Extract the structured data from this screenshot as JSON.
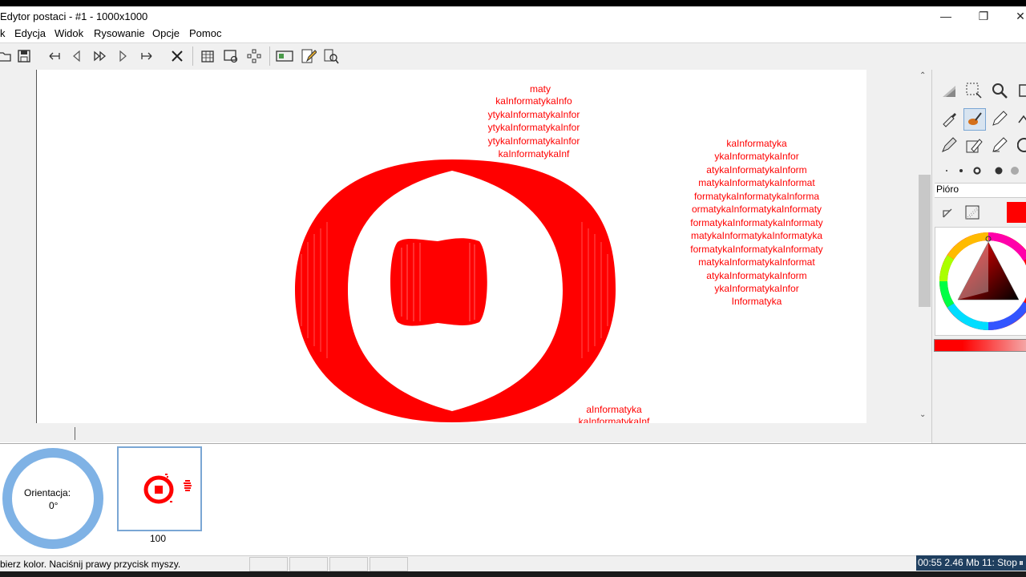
{
  "window": {
    "title": "Edytor postaci - #1 - 1000x1000",
    "controls": {
      "minimize": "—",
      "restore": "❐",
      "close": "✕"
    }
  },
  "menu": [
    "k",
    "Edycja",
    "Widok",
    "Rysowanie",
    "Opcje",
    "Pomoc"
  ],
  "toolbar_icons": [
    "open-icon",
    "save-icon",
    "first-frame-icon",
    "prev-frame-icon",
    "fast-forward-icon",
    "next-frame-icon",
    "last-frame-icon",
    "delete-icon",
    "grid-icon",
    "preview-icon",
    "move-icon",
    "frame-icon",
    "pencil-edit-icon",
    "inspect-icon"
  ],
  "canvas": {
    "text_pattern": "Informatyka",
    "upper_text_lines": [
      "maty",
      "kaInformatykaInfo",
      "ytykaInformatykaInfor",
      "ytykaInformatykaInfor",
      "kaInformatykaInf"
    ],
    "right_text_lines": [
      "kaInformatyka",
      "ykaInformatykaInfor",
      "atykaInformatykaInform",
      "matykaInformatykaInformat",
      "formatykaInformatykaInforma",
      "ormatykaInformatykaInformaty",
      "formatykaInformatykaInformaty",
      "matykaInformatykaInformatyka",
      "formatykaInformatykaInformaty",
      "matykaInformatykaInformat",
      "atykaInformatykaInform",
      "ykaInformatykaInfor",
      "Informatyka"
    ],
    "bottom_text_lines": [
      "aInformatyka",
      "kaInformatykaInf"
    ],
    "draw_color": "#ff0000"
  },
  "right_panel": {
    "tool_label": "Pióro",
    "current_color": "#ff0000"
  },
  "timeline": {
    "orientation_label": "Orientacja:",
    "orientation_value": "0°",
    "frame_duration": "100"
  },
  "statusbar": {
    "hint": "bierz kolor. Naciśnij prawy przycisk myszy.",
    "clock": "00:55 2.46 Mb 11: Stop"
  }
}
